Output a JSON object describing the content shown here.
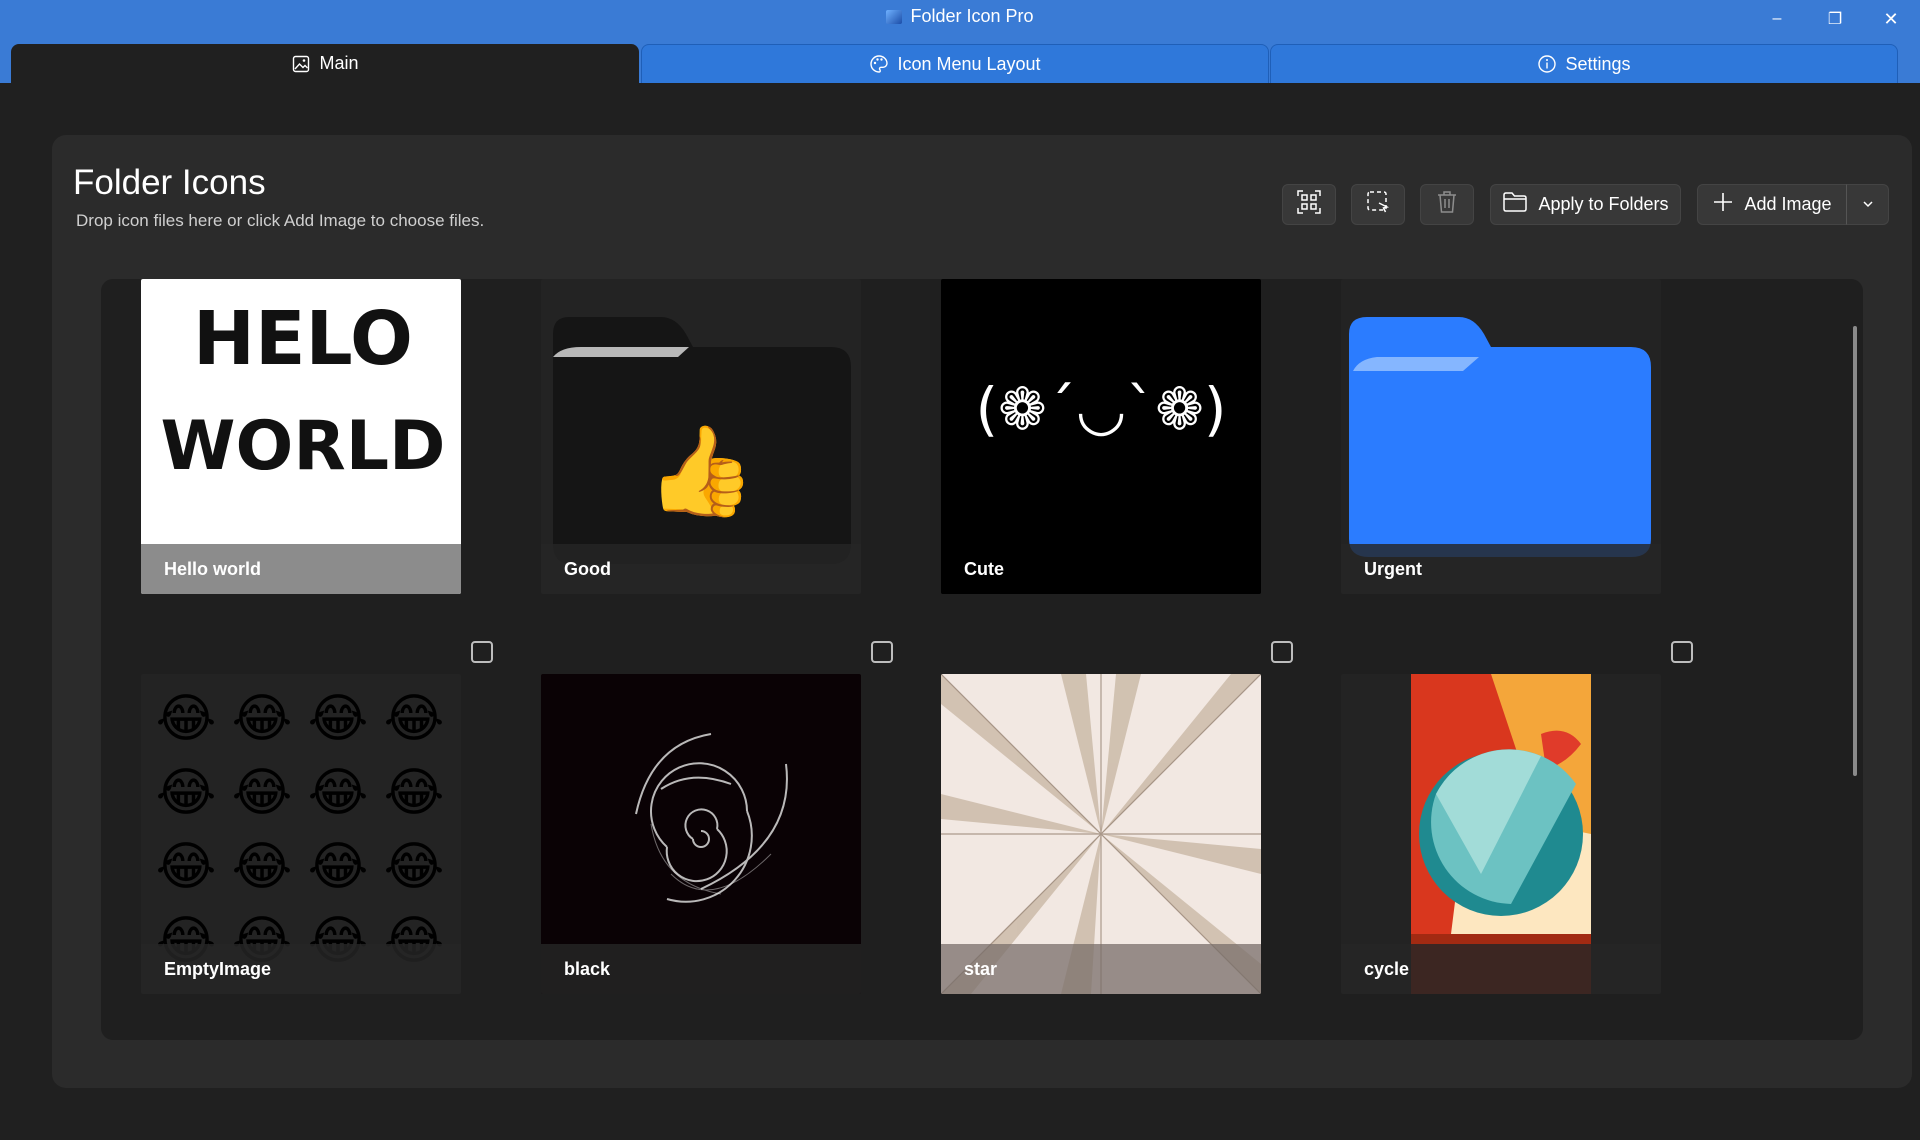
{
  "window": {
    "title": "Folder Icon Pro",
    "controls": {
      "minimize": "–",
      "maximize": "❐",
      "close": "✕"
    }
  },
  "tabs": [
    {
      "label": "Main",
      "icon": "image-icon",
      "active": true
    },
    {
      "label": "Icon Menu Layout",
      "icon": "palette-icon",
      "active": false
    },
    {
      "label": "Settings",
      "icon": "info-icon",
      "active": false
    }
  ],
  "main": {
    "title": "Folder Icons",
    "subtitle": "Drop icon files here or click Add Image to choose files."
  },
  "toolbar": {
    "select_all_icon": "select-all-icon",
    "lasso_icon": "selection-lasso-icon",
    "delete_icon": "trash-icon",
    "apply_label": "Apply to Folders",
    "add_label": "Add Image",
    "add_dropdown_icon": "chevron-down-icon"
  },
  "icons": [
    {
      "name": "Hello world",
      "text_line1": "HELO",
      "text_line2": "WORLD"
    },
    {
      "name": "Good",
      "emoji": "👍"
    },
    {
      "name": "Cute",
      "kaomoji": "(❁´◡`❁)"
    },
    {
      "name": "Urgent"
    },
    {
      "name": "EmptyImage",
      "emoji": "😂"
    },
    {
      "name": "black"
    },
    {
      "name": "star"
    },
    {
      "name": "cycle"
    }
  ],
  "colors": {
    "accent": "#3a7bd5",
    "background": "#202020",
    "card": "#2b2b2b",
    "folder_blue": "#2b7cff"
  }
}
